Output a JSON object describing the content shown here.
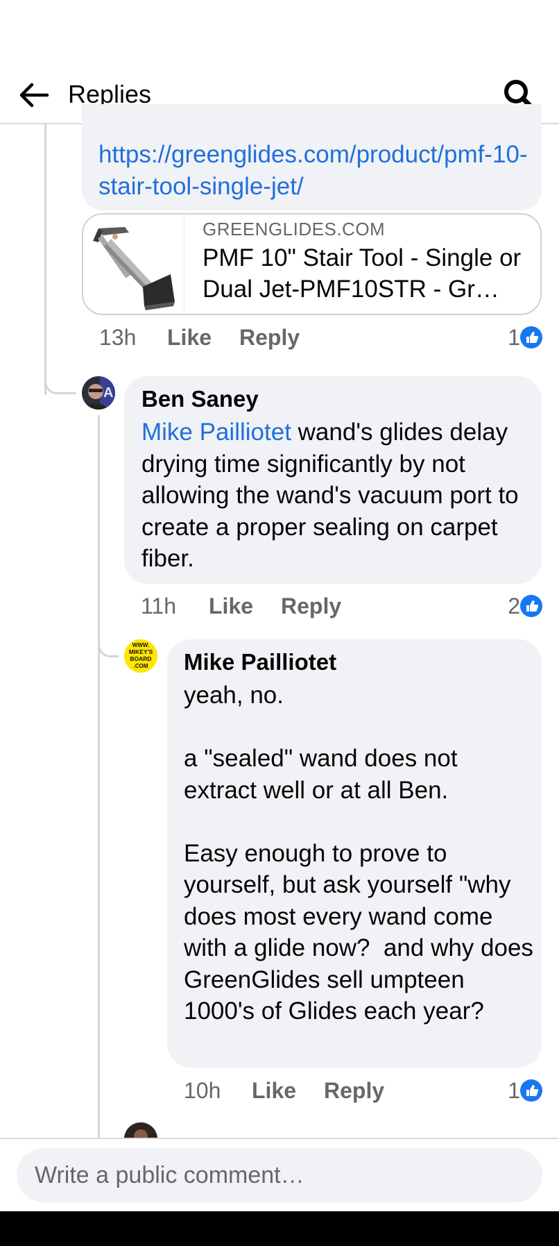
{
  "header": {
    "title": "Replies",
    "back_icon": "arrow-left-icon",
    "search_icon": "search-icon"
  },
  "link_comment": {
    "link_text": "https://greenglides.com/product/pmf-10-stair-tool-single-jet/",
    "preview": {
      "domain": "GREENGLIDES.COM",
      "title": "PMF 10\" Stair Tool - Single or Dual Jet-PMF10STR - Gr…"
    },
    "time": "13h",
    "like_label": "Like",
    "reply_label": "Reply",
    "reaction_count": "1"
  },
  "comments": [
    {
      "author": "Ben Saney",
      "mention": "Mike Pailliotet",
      "text": " wand's glides delay drying time significantly by not allowing the wand's vacuum port to create a proper sealing on carpet fiber.",
      "time": "11h",
      "like_label": "Like",
      "reply_label": "Reply",
      "reaction_count": "2"
    },
    {
      "author": "Mike Pailliotet",
      "avatar_text": [
        "WWW.",
        "MIKEY'S",
        "BOARD",
        ".COM"
      ],
      "text": "yeah, no.\n\na \"sealed\" wand does not extract well or at all Ben.\n\nEasy enough to prove to yourself, but ask yourself \"why does most every wand come with a glide now?  and why does GreenGlides sell umpteen 1000's of Glides each year?",
      "time": "10h",
      "like_label": "Like",
      "reply_label": "Reply",
      "reaction_count": "1"
    }
  ],
  "composer": {
    "placeholder": "Write a public comment…"
  },
  "colors": {
    "link": "#216fdb",
    "bubble": "#f0f2f5",
    "meta": "#65676b",
    "like_blue": "#1877f2"
  }
}
